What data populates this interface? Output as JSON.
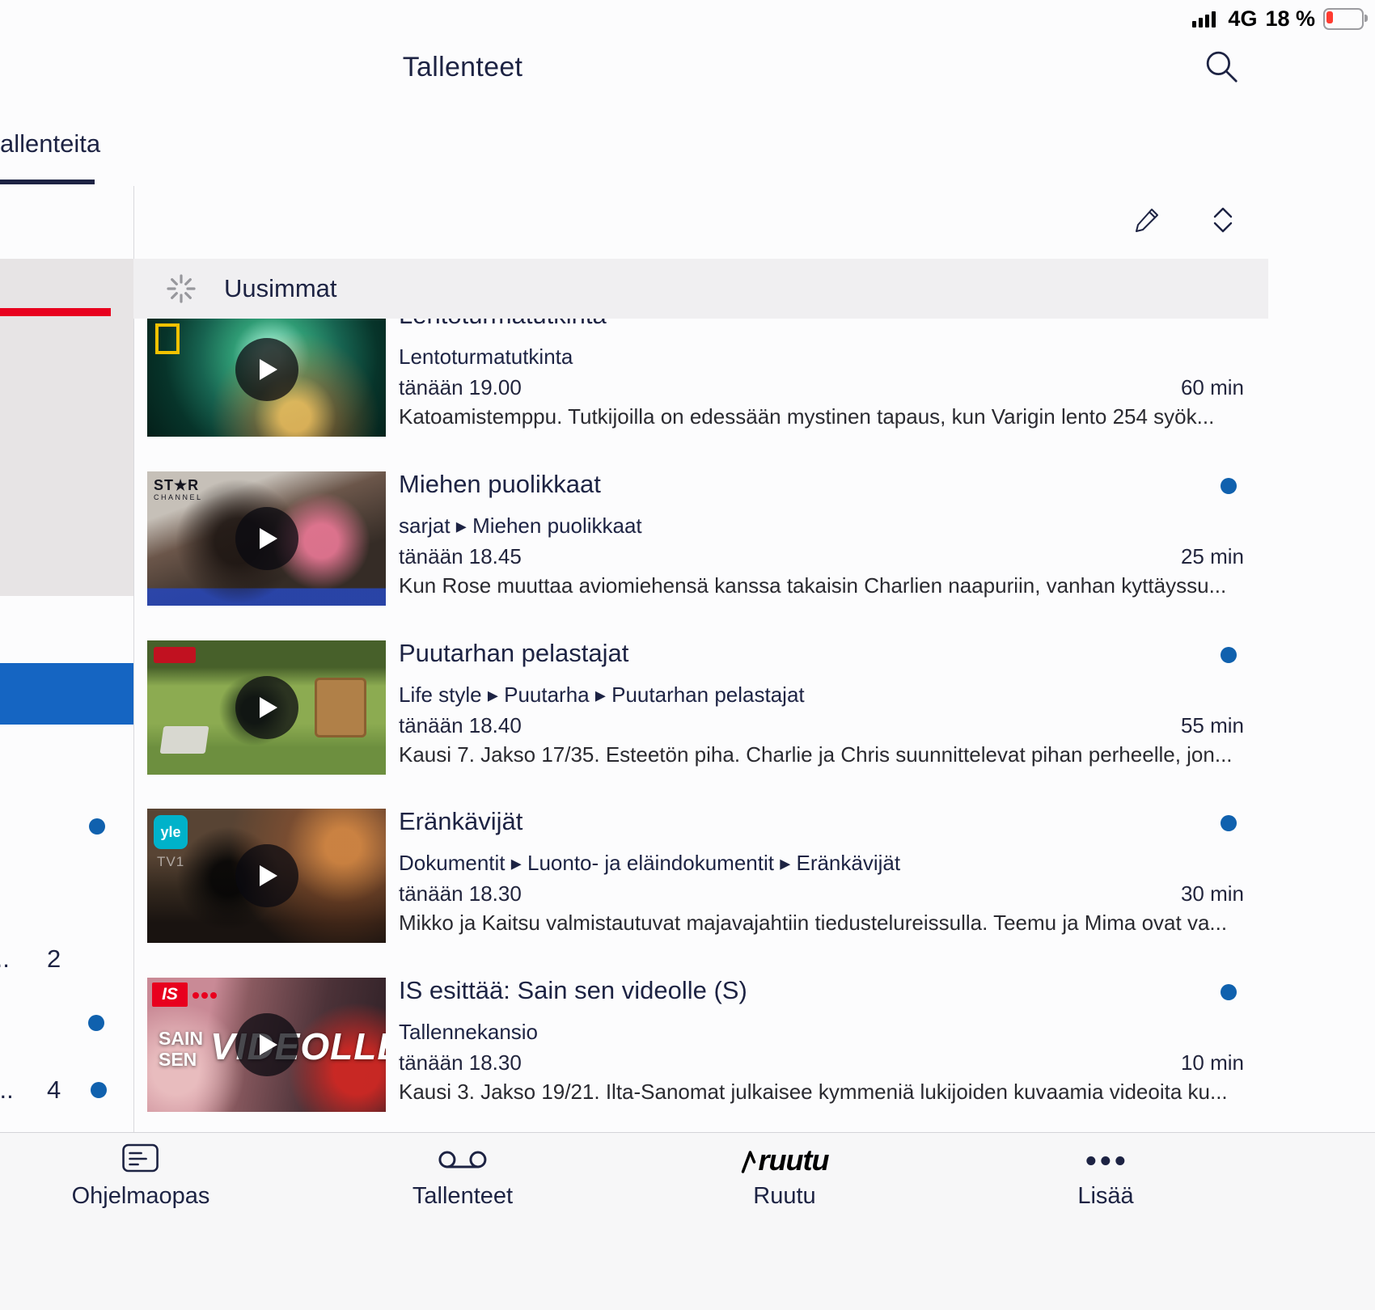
{
  "colors": {
    "accent_blue": "#1061ae",
    "alert_red": "#e8001e",
    "navy": "#1d2343",
    "selected_blue": "#1565c2"
  },
  "status_bar": {
    "network": "4G",
    "battery": "18 %"
  },
  "header": {
    "title": "Tallenteet"
  },
  "left_pane": {
    "tab_label": "allenteita",
    "row_a_prefix": "...",
    "row_a_count": "2",
    "row_b_prefix": "i...",
    "row_b_count": "4"
  },
  "section": {
    "title": "Uusimmat"
  },
  "list": {
    "items": [
      {
        "title": "Lentoturmatutkinta",
        "breadcrumb": "Lentoturmatutkinta",
        "time": "tänään 19.00",
        "duration": "60 min",
        "description": "Katoamistemppu. Tutkijoilla on edessään mystinen tapaus, kun Varigin lento 254 syök..."
      },
      {
        "title": "Miehen puolikkaat",
        "breadcrumb": "sarjat ▸ Miehen puolikkaat",
        "time": "tänään 18.45",
        "duration": "25 min",
        "description": "Kun Rose muuttaa aviomiehensä kanssa takaisin Charlien naapuriin, vanhan kyttäyssu...",
        "badge_top": "ST★R",
        "badge_sub": "CHANNEL"
      },
      {
        "title": "Puutarhan pelastajat",
        "breadcrumb": "Life style ▸ Puutarha ▸ Puutarhan pelastajat",
        "time": "tänään 18.40",
        "duration": "55 min",
        "description": "Kausi 7. Jakso 17/35. Esteetön piha. Charlie ja Chris suunnittelevat pihan perheelle, jon..."
      },
      {
        "title": "Eränkävijät",
        "breadcrumb": "Dokumentit ▸ Luonto- ja eläindokumentit ▸ Eränkävijät",
        "time": "tänään 18.30",
        "duration": "30 min",
        "description": "Mikko ja Kaitsu valmistautuvat majavajahtiin tiedustelureissulla. Teemu ja Mima ovat va...",
        "badge_top": "yle",
        "badge_sub": "TV1"
      },
      {
        "title": "IS esittää: Sain sen videolle (S)",
        "breadcrumb": "Tallennekansio",
        "time": "tänään 18.30",
        "duration": "10 min",
        "description": "Kausi 3. Jakso 19/21. Ilta-Sanomat julkaisee kymmeniä lukijoiden kuvaamia videoita ku...",
        "badge_top": "IS",
        "overlay_line1": "SAIN",
        "overlay_line2": "SEN",
        "overlay_big": "VIDEOLLE"
      }
    ]
  },
  "tab_bar": {
    "logo_text": "ruutu",
    "items": [
      {
        "label": "Ohjelmaopas"
      },
      {
        "label": "Tallenteet"
      },
      {
        "label": "Ruutu"
      },
      {
        "label": "Lisää"
      }
    ]
  }
}
